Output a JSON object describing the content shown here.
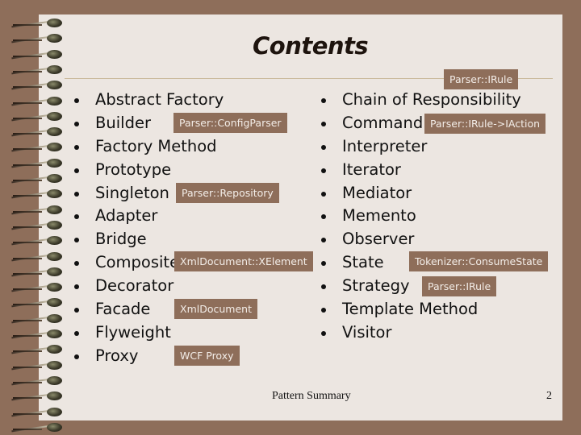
{
  "slide": {
    "title": "Contents",
    "footer_center": "Pattern Summary",
    "page_number": "2",
    "colors": {
      "background": "#8e6e5a",
      "paper": "#ece6e1",
      "tag_bg": "#8e6e5a",
      "tag_text": "#f3ede8",
      "rule": "#c9b99a"
    }
  },
  "header_tag": "Parser::IRule",
  "left_list": [
    {
      "label": "Abstract Factory"
    },
    {
      "label": "Builder",
      "tag": "Parser::ConfigParser"
    },
    {
      "label": "Factory Method"
    },
    {
      "label": "Prototype"
    },
    {
      "label": "Singleton",
      "tag": "Parser::Repository"
    },
    {
      "label": "Adapter"
    },
    {
      "label": "Bridge"
    },
    {
      "label": "Composite",
      "tag": "XmlDocument::XElement"
    },
    {
      "label": "Decorator"
    },
    {
      "label": "Facade",
      "tag": "XmlDocument"
    },
    {
      "label": "Flyweight"
    },
    {
      "label": "Proxy",
      "tag": "WCF Proxy"
    }
  ],
  "right_list": [
    {
      "label": "Chain of Responsibility"
    },
    {
      "label": "Command",
      "tag": "Parser::IRule->IAction"
    },
    {
      "label": "Interpreter"
    },
    {
      "label": "Iterator"
    },
    {
      "label": "Mediator"
    },
    {
      "label": "Memento"
    },
    {
      "label": "Observer"
    },
    {
      "label": "State",
      "tag": "Tokenizer::ConsumeState"
    },
    {
      "label": "Strategy",
      "tag": "Parser::IRule"
    },
    {
      "label": "Template Method"
    },
    {
      "label": "Visitor"
    }
  ],
  "decorations": {
    "spiral_binding_icon": "spiral-coil"
  }
}
